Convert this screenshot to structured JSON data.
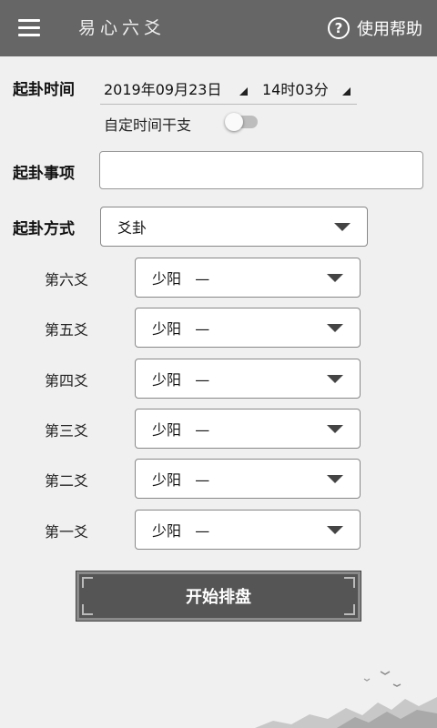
{
  "app": {
    "title": "易心六爻",
    "help_label": "使用帮助"
  },
  "form": {
    "time": {
      "label": "起卦时间",
      "date": "2019年09月23日",
      "time": "14时03分",
      "custom_ganzhi_label": "自定时间干支",
      "custom_ganzhi_enabled": false
    },
    "subject": {
      "label": "起卦事项",
      "value": "",
      "placeholder": ""
    },
    "method": {
      "label": "起卦方式",
      "value": "爻卦"
    },
    "yaos": [
      {
        "label": "第六爻",
        "value": "少阳   —"
      },
      {
        "label": "第五爻",
        "value": "少阳   —"
      },
      {
        "label": "第四爻",
        "value": "少阳   —"
      },
      {
        "label": "第三爻",
        "value": "少阳   —"
      },
      {
        "label": "第二爻",
        "value": "少阳   —"
      },
      {
        "label": "第一爻",
        "value": "少阳   —"
      }
    ],
    "start_label": "开始排盘"
  },
  "colors": {
    "appbar": "#666666",
    "background": "#f0f0f0",
    "button": "#555555"
  },
  "icons": {
    "menu": "menu-icon",
    "help": "help-icon",
    "dropdown": "caret-down-icon"
  }
}
